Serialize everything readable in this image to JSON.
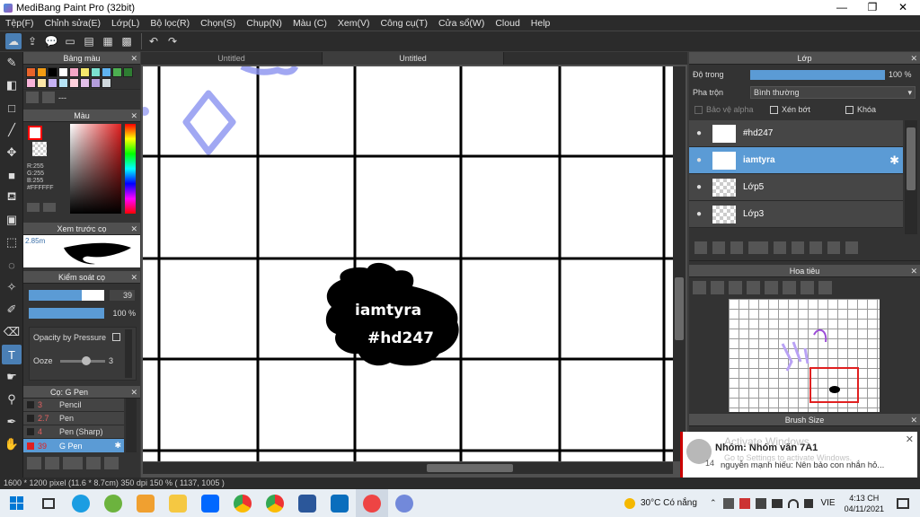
{
  "window": {
    "title": "MediBang Paint Pro (32bit)",
    "minimize": "—",
    "maximize": "❐",
    "close": "✕"
  },
  "menu": [
    "Tệp(F)",
    "Chỉnh sửa(E)",
    "Lớp(L)",
    "Bộ lọc(R)",
    "Chọn(S)",
    "Chụp(N)",
    "Màu (C)",
    "Xem(V)",
    "Công cụ(T)",
    "Cửa sổ(W)",
    "Cloud",
    "Help"
  ],
  "toolbar": {
    "icons": [
      "cloud-icon",
      "export-icon",
      "chat-icon",
      "comment-icon",
      "page-icon",
      "panel-icon",
      "grid-icon",
      "undo-icon",
      "redo-icon"
    ],
    "undo": "↶",
    "redo": "↷"
  },
  "tools": [
    "brush-icon",
    "eraser-icon",
    "rect-icon",
    "line-icon",
    "move-icon",
    "fill-rect-icon",
    "bucket-icon",
    "gradient-icon",
    "select-rect-icon",
    "lasso-icon",
    "magic-wand-icon",
    "select-pen-icon",
    "select-eraser-icon",
    "text-icon",
    "hand-select-icon",
    "eyedropper-icon",
    "dropper-icon",
    "hand-icon"
  ],
  "palette": {
    "title": "Bảng màu",
    "colors": [
      "#e8632a",
      "#f39c12",
      "#000000",
      "#ffffff",
      "#f4a6c6",
      "#f5e66b",
      "#7be0d1",
      "#5fb3f0",
      "#4caf50",
      "#2e7d32",
      "#f8b4d9",
      "#fde7a8",
      "#c7b3f5",
      "#b6e3f5",
      "#ffd1dc",
      "#e1bee7",
      "#b39ddb",
      "#cfd8dc"
    ],
    "label": "---"
  },
  "color": {
    "title": "Màu",
    "r": "R:255",
    "g": "G:255",
    "b": "B:255",
    "hex": "#FFFFFF",
    "fg": "#ff0000"
  },
  "preview": {
    "title": "Xem trước cọ",
    "size": "2.85m"
  },
  "brush_control": {
    "title": "Kiểm soát cọ",
    "size": "39",
    "size_level": 0.7,
    "opacity": "100 %",
    "opacity_level": 1.0,
    "pressure": "Opacity by Pressure",
    "ooze_label": "Ooze",
    "ooze_val": "3"
  },
  "brushes": {
    "title": "Cọ: G Pen",
    "items": [
      {
        "size": "3",
        "name": "Pencil"
      },
      {
        "size": "2.7",
        "name": "Pen"
      },
      {
        "size": "4",
        "name": "Pen (Sharp)"
      },
      {
        "size": "39",
        "name": "G Pen"
      }
    ]
  },
  "tabs": [
    "Untitled",
    "Untitled"
  ],
  "canvas_text": {
    "line1": "iamtyra",
    "line2": "#hd247"
  },
  "layers": {
    "title": "Lớp",
    "opacity_label": "Độ trong",
    "opacity_value": "100 %",
    "opacity_level": 1.0,
    "blend_label": "Pha trộn",
    "blend_value": "Bình thường",
    "alpha_lock": "Bảo vệ alpha",
    "clip": "Xén bớt",
    "lock": "Khóa",
    "items": [
      "#hd247",
      "iamtyra",
      "Lớp5",
      "Lớp3"
    ]
  },
  "navigator": {
    "title": "Hoa tiêu"
  },
  "brush_size": {
    "title": "Brush Size"
  },
  "status": "1600 * 1200 pixel   (11.6 * 8.7cm)   350 dpi   150 %   ( 1137, 1005 )",
  "notification": {
    "group": "Nhóm: Nhóm văn 7A1",
    "message": "nguyễn mạnh hiếu: Nên bảo con nhắn hỏ...",
    "count": "14",
    "wm1": "Activate Windows",
    "wm2": "Go to Settings to activate Windows."
  },
  "taskbar": {
    "weather": "30°C  Có nắng",
    "lang": "VIE",
    "time": "4:13 CH",
    "date": "04/11/2021"
  }
}
